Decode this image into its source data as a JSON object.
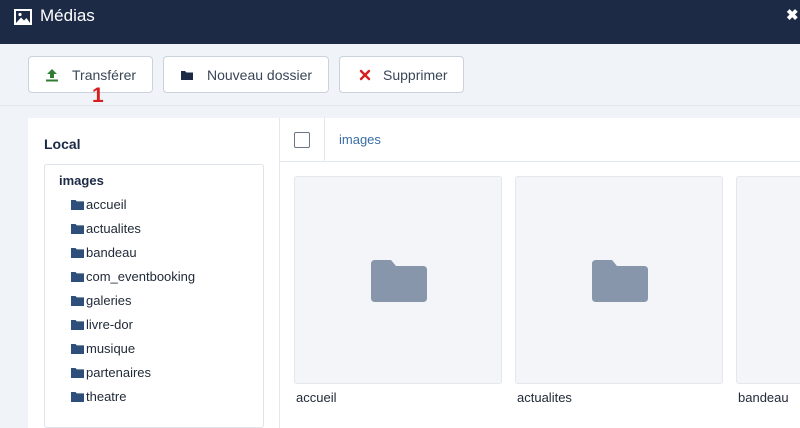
{
  "window": {
    "title": "Médias",
    "close_glyph": "✖",
    "title_icon": "image-icon"
  },
  "toolbar": {
    "upload_label": "Transférer",
    "new_folder_label": "Nouveau dossier",
    "delete_label": "Supprimer",
    "upload_color": "#2e7d32",
    "delete_color": "#d61f1f"
  },
  "annotation": "1",
  "sidebar": {
    "title": "Local",
    "root": "images",
    "items": [
      "accueil",
      "actualites",
      "bandeau",
      "com_eventbooking",
      "galeries",
      "livre-dor",
      "musique",
      "partenaires",
      "theatre"
    ]
  },
  "main": {
    "breadcrumb": "images",
    "folders": [
      {
        "name": "accueil"
      },
      {
        "name": "actualites"
      },
      {
        "name": "bandeau"
      }
    ]
  },
  "colors": {
    "titlebar_bg": "#1c2a45",
    "folder_icon_small": "#2e4f7a",
    "folder_icon_large": "#8896ab",
    "link": "#3a6ea5"
  }
}
